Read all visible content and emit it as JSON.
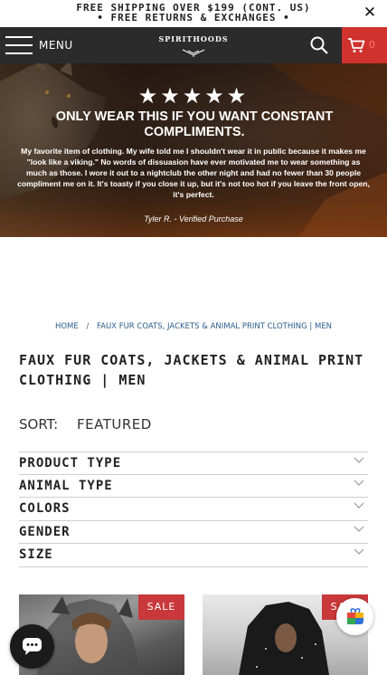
{
  "announcement": {
    "line1": "FREE SHIPPING OVER $199 (CONT. US)",
    "line2": "• FREE RETURNS & EXCHANGES •"
  },
  "header": {
    "menu_label": "MENU",
    "logo_text": "SPIRITHOODS",
    "cart_count": "0"
  },
  "hero": {
    "stars": "★★★★★",
    "headline": "ONLY WEAR THIS IF YOU WANT CONSTANT COMPLIMENTS.",
    "quote": "My favorite item of clothing. My wife told me I shouldn't wear it in public because it makes me \"look like a viking.\" No words of dissuasion have ever motivated me to wear something as much as those. I wore it out to a nightclub the other night and had no fewer than 30 people compliment me on it. It's toasty if you close it up, but it's not too hot if you leave the front open, it's perfect.",
    "author": "Tyler R. - Verified Purchase"
  },
  "breadcrumb": {
    "home": "HOME",
    "separator": "/",
    "current": "FAUX FUR COATS, JACKETS & ANIMAL PRINT CLOTHING | MEN"
  },
  "page_title": "FAUX FUR COATS, JACKETS & ANIMAL PRINT CLOTHING | MEN",
  "sort": {
    "label": "SORT:",
    "value": "FEATURED"
  },
  "filters": [
    {
      "label": "PRODUCT TYPE"
    },
    {
      "label": "ANIMAL TYPE"
    },
    {
      "label": "COLORS"
    },
    {
      "label": "GENDER"
    },
    {
      "label": "SIZE"
    }
  ],
  "products": [
    {
      "badge": "SALE"
    },
    {
      "badge": "SALE"
    }
  ],
  "colors": {
    "nav_bg": "#2b2b2b",
    "cart_bg": "#d0322e",
    "sale_badge": "#c9383a",
    "link": "#2a5c8a"
  }
}
